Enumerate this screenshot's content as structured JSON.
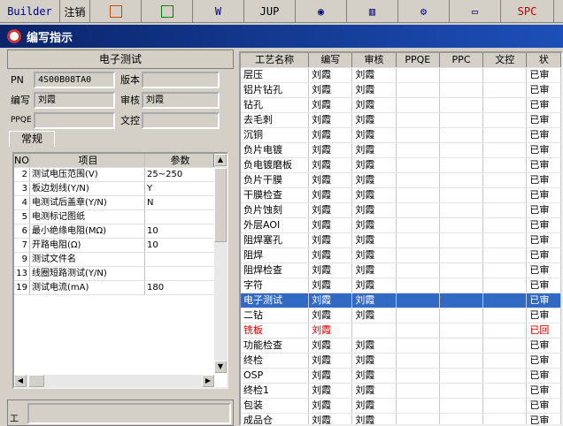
{
  "toolbar": {
    "items": [
      "Builder",
      "注销",
      "",
      "",
      "W",
      "JUP",
      "",
      "",
      "",
      "",
      "SPC"
    ],
    "builder": "Builder",
    "logout": "注销",
    "word": "W",
    "jup": "JUP",
    "spc": "SPC"
  },
  "window_title": "编写指示",
  "left": {
    "header": "电子测试",
    "pn_label": "PN",
    "pn_value": "4S00B08TA0",
    "version_label": "版本",
    "version_value": "",
    "author_label": "编写",
    "author_value": "刘霞",
    "reviewer_label": "审核",
    "reviewer_value": "刘霞",
    "ppqe_label": "PPQE",
    "ppqe_value": "",
    "doc_label": "文控",
    "doc_value": "",
    "tab": "常规",
    "param_headers": [
      "NO",
      "项目",
      "参数"
    ],
    "params": [
      [
        "2",
        "测试电压范围(V)",
        "25~250"
      ],
      [
        "3",
        "板边划线(Y/N)",
        "Y"
      ],
      [
        "4",
        "电测试后盖章(Y/N)",
        "N"
      ],
      [
        "5",
        "电测标记图纸",
        ""
      ],
      [
        "6",
        "最小绝缘电阻(MΩ)",
        "10"
      ],
      [
        "7",
        "开路电阻(Ω)",
        "10"
      ],
      [
        "9",
        "测试文件名",
        ""
      ],
      [
        "13",
        "线圈短路测试(Y/N)",
        ""
      ],
      [
        "19",
        "测试电流(mA)",
        "180"
      ]
    ],
    "bottom_label": "工"
  },
  "right": {
    "headers": [
      "工艺名称",
      "编写",
      "审核",
      "PPQE",
      "PPC",
      "文控",
      "状"
    ],
    "rows": [
      [
        "层压",
        "刘霞",
        "刘霞",
        "",
        "",
        "",
        "已审"
      ],
      [
        "铝片钻孔",
        "刘霞",
        "刘霞",
        "",
        "",
        "",
        "已审"
      ],
      [
        "钻孔",
        "刘霞",
        "刘霞",
        "",
        "",
        "",
        "已审"
      ],
      [
        "去毛刺",
        "刘霞",
        "刘霞",
        "",
        "",
        "",
        "已审"
      ],
      [
        "沉铜",
        "刘霞",
        "刘霞",
        "",
        "",
        "",
        "已审"
      ],
      [
        "负片电镀",
        "刘霞",
        "刘霞",
        "",
        "",
        "",
        "已审"
      ],
      [
        "负电镀磨板",
        "刘霞",
        "刘霞",
        "",
        "",
        "",
        "已审"
      ],
      [
        "负片干膜",
        "刘霞",
        "刘霞",
        "",
        "",
        "",
        "已审"
      ],
      [
        "干膜检查",
        "刘霞",
        "刘霞",
        "",
        "",
        "",
        "已审"
      ],
      [
        "负片蚀刻",
        "刘霞",
        "刘霞",
        "",
        "",
        "",
        "已审"
      ],
      [
        "外层AOI",
        "刘霞",
        "刘霞",
        "",
        "",
        "",
        "已审"
      ],
      [
        "阻焊塞孔",
        "刘霞",
        "刘霞",
        "",
        "",
        "",
        "已审"
      ],
      [
        "阻焊",
        "刘霞",
        "刘霞",
        "",
        "",
        "",
        "已审"
      ],
      [
        "阻焊检查",
        "刘霞",
        "刘霞",
        "",
        "",
        "",
        "已审"
      ],
      [
        "字符",
        "刘霞",
        "刘霞",
        "",
        "",
        "",
        "已审"
      ],
      [
        "电子测试",
        "刘霞",
        "刘霞",
        "",
        "",
        "",
        "已审"
      ],
      [
        "二钻",
        "刘霞",
        "刘霞",
        "",
        "",
        "",
        "已审"
      ],
      [
        "铣板",
        "刘霞",
        "",
        "",
        "",
        "",
        "已回"
      ],
      [
        "功能检查",
        "刘霞",
        "刘霞",
        "",
        "",
        "",
        "已审"
      ],
      [
        "终检",
        "刘霞",
        "刘霞",
        "",
        "",
        "",
        "已审"
      ],
      [
        "OSP",
        "刘霞",
        "刘霞",
        "",
        "",
        "",
        "已审"
      ],
      [
        "终检1",
        "刘霞",
        "刘霞",
        "",
        "",
        "",
        "已审"
      ],
      [
        "包装",
        "刘霞",
        "刘霞",
        "",
        "",
        "",
        "已审"
      ],
      [
        "成品仓",
        "刘霞",
        "刘霞",
        "",
        "",
        "",
        "已审"
      ]
    ],
    "selected_row": "电子测试",
    "red_row": "铣板"
  }
}
